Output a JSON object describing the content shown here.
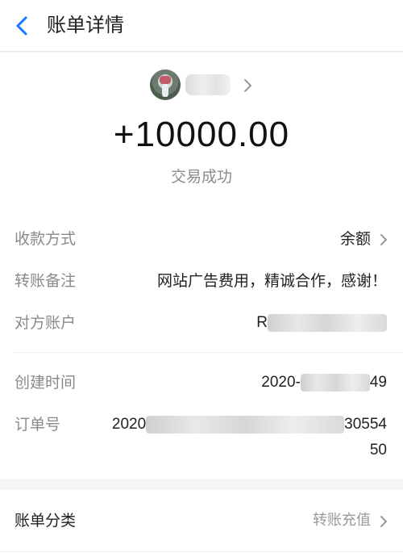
{
  "header": {
    "title": "账单详情",
    "back_icon": "back-arrow-icon",
    "accent": "#1677ff"
  },
  "payee": {
    "avatar_icon": "avatar",
    "name": "",
    "chevron_icon": "chevron-right-icon"
  },
  "transaction": {
    "amount": "+10000.00",
    "status": "交易成功"
  },
  "details": {
    "payment_method": {
      "label": "收款方式",
      "value": "余额"
    },
    "transfer_note": {
      "label": "转账备注",
      "value": "网站广告费用，精诚合作，感谢！"
    },
    "counterparty": {
      "label": "对方账户",
      "value_visible": "R"
    },
    "created_time": {
      "label": "创建时间",
      "value_prefix": "2020-",
      "value_suffix": "49"
    },
    "order_no": {
      "label": "订单号",
      "value_prefix": "2020",
      "value_suffix": "30554",
      "value_line2": "50"
    }
  },
  "category": {
    "label": "账单分类",
    "value": "转账充值"
  }
}
